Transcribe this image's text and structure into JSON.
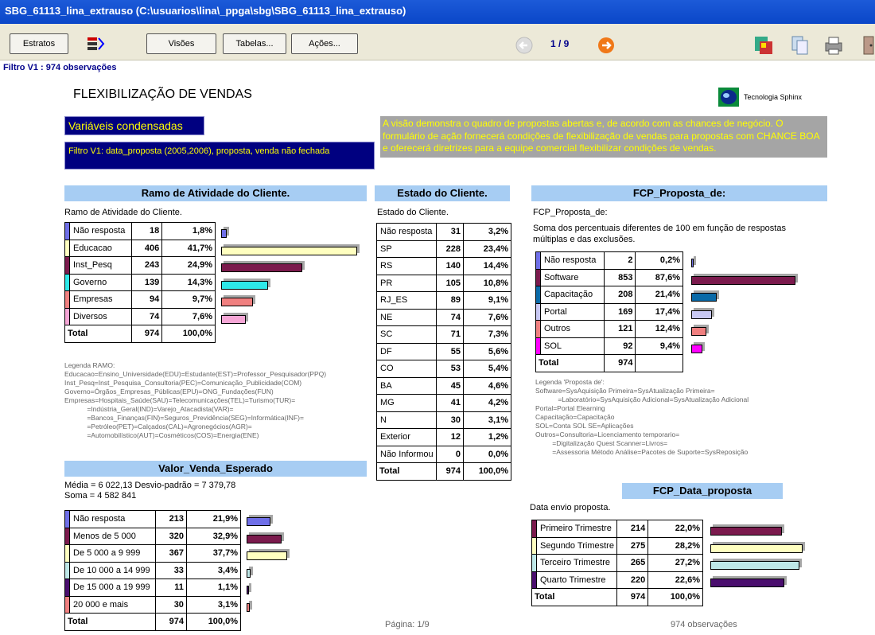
{
  "window": {
    "title": "SBG_61113_lina_extrauso (C:\\usuarios\\lina\\_ppga\\sbg\\SBG_61113_lina_extrauso)"
  },
  "toolbar": {
    "estratos": "Estratos",
    "visoes": "Visões",
    "tabelas": "Tabelas...",
    "acoes": "Ações...",
    "page_indicator": "1 / 9",
    "filter_line": "Filtro V1 : 974 observações"
  },
  "icons": {
    "stratify": "stratify-icon",
    "back": "back-arrow-icon",
    "forward": "forward-arrow-icon",
    "export": "export-icon",
    "copy": "copy-icon",
    "print": "print-icon",
    "exit": "exit-door-icon"
  },
  "page": {
    "title": "FLEXIBILIZAÇÃO DE VENDAS",
    "logo_text": "Tecnologia Sphinx",
    "var_label": "Variáveis condensadas",
    "filter_text": "Filtro V1: data_proposta (2005,2006), proposta, venda não fechada",
    "description": "A visão demonstra o quadro de propostas abertas e, de acordo com as chances de negócio. O formulário de ação fornecerá condições de flexibilização de vendas para propostas com CHANCE BOA e oferecerá diretrizes para a equipe comercial flexibilizar condições de vendas."
  },
  "ramo": {
    "header": "Ramo de Atividade do Cliente.",
    "subtitle": "Ramo de Atividade do Cliente.",
    "rows": [
      {
        "label": "Não resposta",
        "count": "18",
        "pct": "1,8%",
        "value": 1.8,
        "color": "#6f6fe8"
      },
      {
        "label": "Educacao",
        "count": "406",
        "pct": "41,7%",
        "value": 41.7,
        "color": "#ffffc0"
      },
      {
        "label": "Inst_Pesq",
        "count": "243",
        "pct": "24,9%",
        "value": 24.9,
        "color": "#7b1a4d"
      },
      {
        "label": "Governo",
        "count": "139",
        "pct": "14,3%",
        "value": 14.3,
        "color": "#2de8e8"
      },
      {
        "label": "Empresas",
        "count": "94",
        "pct": "9,7%",
        "value": 9.7,
        "color": "#f08080"
      },
      {
        "label": "Diversos",
        "count": "74",
        "pct": "7,6%",
        "value": 7.6,
        "color": "#f6a6d6"
      }
    ],
    "total": {
      "label": "Total",
      "count": "974",
      "pct": "100,0%"
    },
    "legend": "Legenda RAMO:\nEducacao=Ensino_Universidade(EDU)=Estudante(EST)=Professor_Pesquisador(PPQ)\nInst_Pesq=Inst_Pesquisa_Consultoria(PEC)=Comunicação_Publicidade(COM)\nGoverno=Órgãos_Empresas_Públicas(EPU)=ONG_Fundações(FUN)\nEmpresas=Hospitais_Saúde(SAU)=Telecomunicações(TEL)=Turismo(TUR)=\n            =Indústria_Geral(IND)=Varejo_Atacadista(VAR)=\n            =Bancos_Finanças(FIN)=Seguros_Previdência(SEG)=Informática(INF)=\n            =Petróleo(PET)=Calçados(CAL)=Agronegócios(AGR)=\n            =Automobilístico(AUT)=Cosméticos(COS)=Energia(ENE)"
  },
  "valor": {
    "header": "Valor_Venda_Esperado",
    "stats1": "Média = 6 022,13  Desvio-padrão = 7 379,78",
    "stats2": "Soma = 4 582 841",
    "rows": [
      {
        "label": "Não resposta",
        "count": "213",
        "pct": "21,9%",
        "value": 21.9,
        "color": "#6f6fe8"
      },
      {
        "label": "Menos de 5 000",
        "count": "320",
        "pct": "32,9%",
        "value": 32.9,
        "color": "#7b1a4d"
      },
      {
        "label": "De 5 000 a 9 999",
        "count": "367",
        "pct": "37,7%",
        "value": 37.7,
        "color": "#ffffc0"
      },
      {
        "label": "De 10 000 a 14 999",
        "count": "33",
        "pct": "3,4%",
        "value": 3.4,
        "color": "#bfe8e8"
      },
      {
        "label": "De 15 000 a 19 999",
        "count": "11",
        "pct": "1,1%",
        "value": 1.1,
        "color": "#4a0e6e"
      },
      {
        "label": "20 000 e mais",
        "count": "30",
        "pct": "3,1%",
        "value": 3.1,
        "color": "#f08080"
      }
    ],
    "total": {
      "label": "Total",
      "count": "974",
      "pct": "100,0%"
    }
  },
  "estado": {
    "header": "Estado do Cliente.",
    "subtitle": "Estado do Cliente.",
    "rows": [
      {
        "label": "Não resposta",
        "count": "31",
        "pct": "3,2%"
      },
      {
        "label": "SP",
        "count": "228",
        "pct": "23,4%"
      },
      {
        "label": "RS",
        "count": "140",
        "pct": "14,4%"
      },
      {
        "label": "PR",
        "count": "105",
        "pct": "10,8%"
      },
      {
        "label": "RJ_ES",
        "count": "89",
        "pct": "9,1%"
      },
      {
        "label": "NE",
        "count": "74",
        "pct": "7,6%"
      },
      {
        "label": "SC",
        "count": "71",
        "pct": "7,3%"
      },
      {
        "label": "DF",
        "count": "55",
        "pct": "5,6%"
      },
      {
        "label": "CO",
        "count": "53",
        "pct": "5,4%"
      },
      {
        "label": "BA",
        "count": "45",
        "pct": "4,6%"
      },
      {
        "label": "MG",
        "count": "41",
        "pct": "4,2%"
      },
      {
        "label": "N",
        "count": "30",
        "pct": "3,1%"
      },
      {
        "label": "Exterior",
        "count": "12",
        "pct": "1,2%"
      },
      {
        "label": "Não Informou",
        "count": "0",
        "pct": "0,0%"
      }
    ],
    "total": {
      "label": "Total",
      "count": "974",
      "pct": "100,0%"
    }
  },
  "fcp": {
    "header": "FCP_Proposta_de:",
    "subtitle": "FCP_Proposta_de:",
    "note": "Soma dos percentuais diferentes de 100 em função de respostas múltiplas e das exclusões.",
    "rows": [
      {
        "label": "Não resposta",
        "count": "2",
        "pct": "0,2%",
        "value": 0.2,
        "color": "#6f6fe8"
      },
      {
        "label": "Software",
        "count": "853",
        "pct": "87,6%",
        "value": 87.6,
        "color": "#7b1a4d"
      },
      {
        "label": "Capacitação",
        "count": "208",
        "pct": "21,4%",
        "value": 21.4,
        "color": "#0a6aa8"
      },
      {
        "label": "Portal",
        "count": "169",
        "pct": "17,4%",
        "value": 17.4,
        "color": "#c8c8f4"
      },
      {
        "label": "Outros",
        "count": "121",
        "pct": "12,4%",
        "value": 12.4,
        "color": "#f08080"
      },
      {
        "label": "SOL",
        "count": "92",
        "pct": "9,4%",
        "value": 9.4,
        "color": "#ff00ff"
      }
    ],
    "total": {
      "label": "Total",
      "count": "974",
      "pct": ""
    },
    "legend": "Legenda 'Proposta de':\nSoftware=SysAquisição Primeira=SysAtualização Primeira=\n            =Laboratório=SysAquisição Adicional=SysAtualização Adicional\nPortal=Portal Elearning\nCapacitação=Capacitação\nSOL=Conta SOL SE=Aplicações\nOutros=Consultoria=Licenciamento temporario=\n         =Digitalização Quest Scanner=Livros=\n         =Assessoria Método Análise=Pacotes de Suporte=SysReposição"
  },
  "data": {
    "header": "FCP_Data_proposta",
    "subtitle": "Data envio proposta.",
    "rows": [
      {
        "label": "Primeiro Trimestre",
        "count": "214",
        "pct": "22,0%",
        "value": 22.0,
        "color": "#7b1a4d"
      },
      {
        "label": "Segundo Trimestre",
        "count": "275",
        "pct": "28,2%",
        "value": 28.2,
        "color": "#ffffc0"
      },
      {
        "label": "Terceiro Trimestre",
        "count": "265",
        "pct": "27,2%",
        "value": 27.2,
        "color": "#bfe8e8"
      },
      {
        "label": "Quarto Trimestre",
        "count": "220",
        "pct": "22,6%",
        "value": 22.6,
        "color": "#4a0e6e"
      }
    ],
    "total": {
      "label": "Total",
      "count": "974",
      "pct": "100,0%"
    }
  },
  "footer": {
    "page": "Página: 1/9",
    "obs": "974 observações"
  }
}
